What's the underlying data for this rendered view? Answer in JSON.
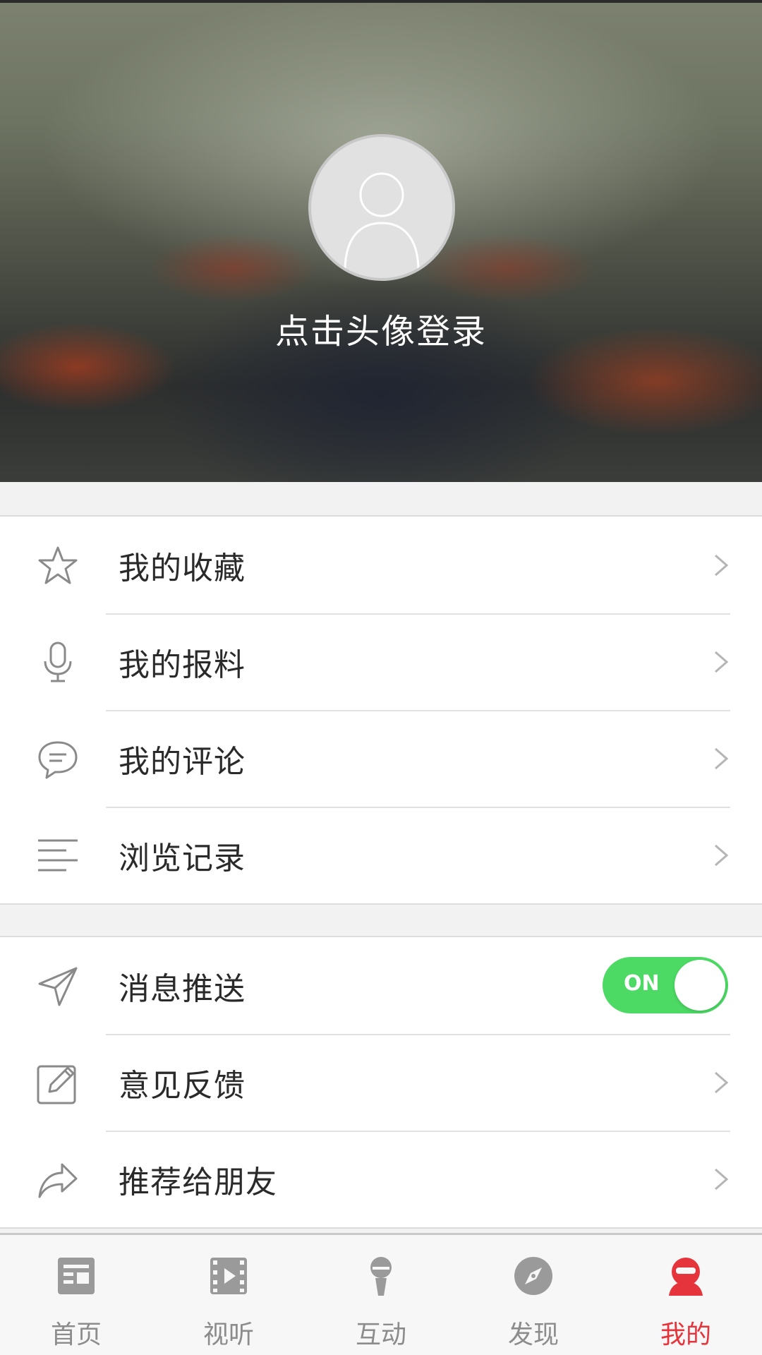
{
  "header": {
    "login_hint": "点击头像登录"
  },
  "menu_group_1": [
    {
      "label": "我的收藏",
      "icon": "star-icon"
    },
    {
      "label": "我的报料",
      "icon": "microphone-icon"
    },
    {
      "label": "我的评论",
      "icon": "comment-bubble-icon"
    },
    {
      "label": "浏览记录",
      "icon": "history-lines-icon"
    }
  ],
  "menu_group_2": {
    "push": {
      "label": "消息推送",
      "icon": "paper-plane-icon",
      "toggle_text": "ON",
      "toggle_on": true
    },
    "feedback": {
      "label": "意见反馈",
      "icon": "edit-pencil-icon"
    },
    "share": {
      "label": "推荐给朋友",
      "icon": "share-arrow-icon"
    }
  },
  "tabbar": {
    "tabs": [
      {
        "label": "首页",
        "icon": "news-icon"
      },
      {
        "label": "视听",
        "icon": "video-film-icon"
      },
      {
        "label": "互动",
        "icon": "microphone-icon"
      },
      {
        "label": "发现",
        "icon": "compass-icon"
      },
      {
        "label": "我的",
        "icon": "user-profile-icon"
      }
    ],
    "active_index": 4
  },
  "colors": {
    "accent_red": "#e5343b",
    "toggle_green": "#4cd964",
    "inactive_gray": "#8c8c8c"
  }
}
